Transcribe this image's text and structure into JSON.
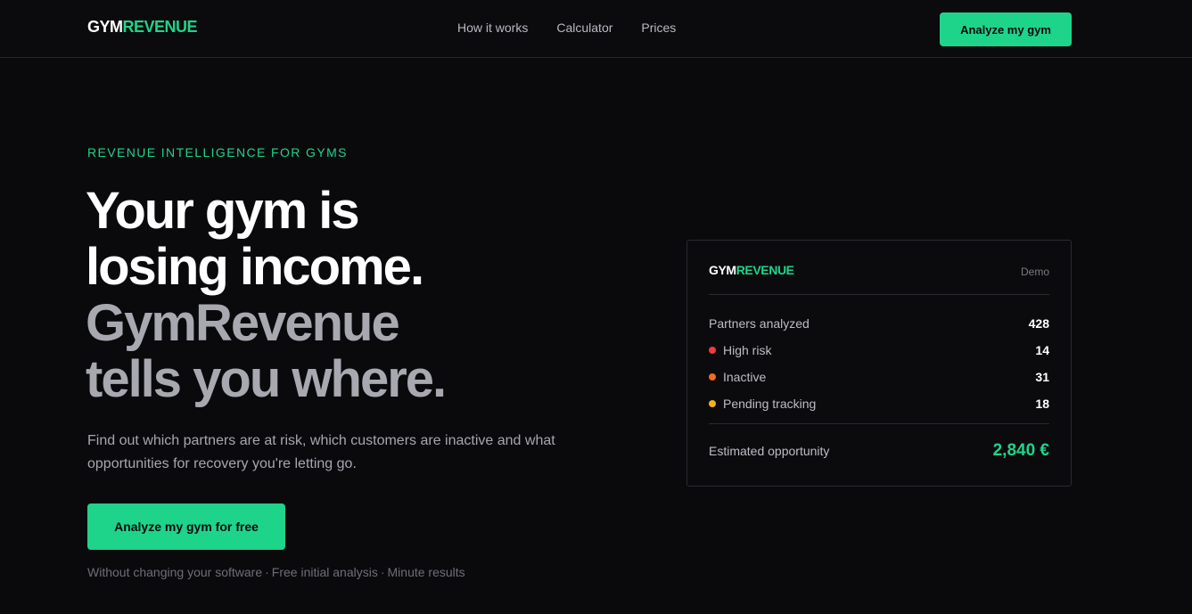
{
  "header": {
    "logo_part1": "GYM",
    "logo_part2": "REVENUE",
    "nav": [
      {
        "label": "How it works"
      },
      {
        "label": "Calculator"
      },
      {
        "label": "Prices"
      }
    ],
    "cta_label": "Analyze my gym"
  },
  "hero": {
    "eyebrow": "REVENUE INTELLIGENCE FOR GYMS",
    "headline_line1": "Your gym is",
    "headline_line2": "losing income.",
    "headline_line3": "GymRevenue",
    "headline_line4": "tells you where.",
    "subtext": "Find out which partners are at risk, which customers are inactive and what opportunities for recovery you're letting go.",
    "cta_label": "Analyze my gym for free",
    "footnote_items": [
      "Without changing your software",
      "Free initial analysis",
      "Minute results"
    ],
    "footnote_separator": "·"
  },
  "card": {
    "logo_part1": "GYM",
    "logo_part2": "REVENUE",
    "badge": "Demo",
    "rows": [
      {
        "label": "Partners analyzed",
        "value": "428",
        "dot_color": ""
      },
      {
        "label": "High risk",
        "value": "14",
        "dot_color": "#ef3b3b"
      },
      {
        "label": "Inactive",
        "value": "31",
        "dot_color": "#f06a22"
      },
      {
        "label": "Pending tracking",
        "value": "18",
        "dot_color": "#f2b21c"
      }
    ],
    "opportunity_label": "Estimated opportunity",
    "opportunity_value": "2,840 €"
  },
  "colors": {
    "accent": "#1ed48a",
    "background": "#0a0a0d"
  }
}
